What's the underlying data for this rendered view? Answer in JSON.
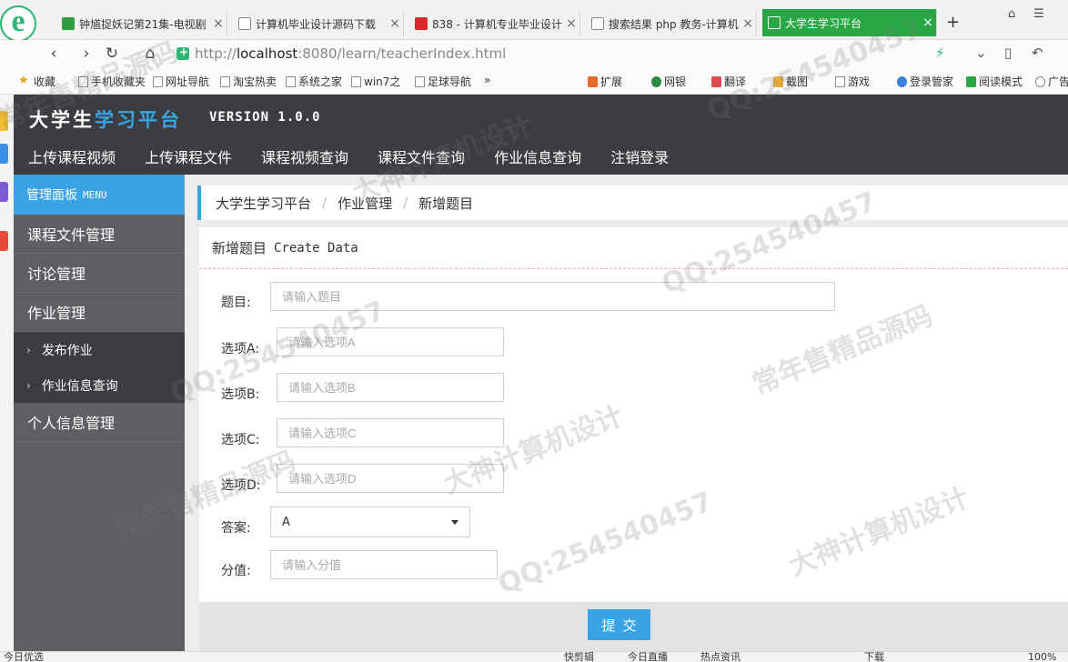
{
  "browser": {
    "logo_letter": "e",
    "tabs": [
      {
        "title": "钟馗捉妖记第21集-电视剧",
        "favicon_color": "#2e9e3e"
      },
      {
        "title": "计算机毕业设计源码下载",
        "favicon_color": "#ffffff"
      },
      {
        "title": "838 - 计算机专业毕业设计",
        "favicon_color": "#d62a2a"
      },
      {
        "title": "搜索结果 php 教务-计算机",
        "favicon_color": "#ffffff"
      },
      {
        "title": "大学生学习平台",
        "favicon_color": "#ffffff",
        "active": true
      }
    ],
    "new_tab": "+",
    "url": {
      "prefix": "http://",
      "host": "localhost",
      "rest": ":8080/learn/teacherIndex.html"
    },
    "bookmarks": [
      {
        "label": "收藏",
        "icon": "star-icon"
      },
      {
        "label": "手机收藏夹",
        "icon": "phone-icon"
      },
      {
        "label": "网址导航",
        "icon": "page-icon"
      },
      {
        "label": "淘宝热卖",
        "icon": "page-icon"
      },
      {
        "label": "系统之家",
        "icon": "page-icon"
      },
      {
        "label": "win7之",
        "icon": "page-icon"
      },
      {
        "label": "足球导航",
        "icon": "page-icon"
      }
    ],
    "bookmarks_more": "»",
    "right_tools": [
      {
        "label": "扩展",
        "icon": "grid-icon"
      },
      {
        "label": "网银",
        "icon": "bank-icon"
      },
      {
        "label": "翻译",
        "icon": "translate-icon"
      },
      {
        "label": "截图",
        "icon": "scissors-icon"
      },
      {
        "label": "游戏",
        "icon": "game-icon"
      },
      {
        "label": "登录管家",
        "icon": "key-icon"
      },
      {
        "label": "阅读模式",
        "icon": "book-icon"
      },
      {
        "label": "广告",
        "icon": "block-icon"
      }
    ]
  },
  "app": {
    "title_white": "大学生",
    "title_blue": "学习平台",
    "version": "VERSION 1.0.0",
    "topnav": [
      "上传课程视频",
      "上传课程文件",
      "课程视频查询",
      "课程文件查询",
      "作业信息查询",
      "注销登录"
    ],
    "sidebar": {
      "head": "管理面板",
      "head_mono": "MENU",
      "items": [
        "课程文件管理",
        "讨论管理",
        "作业管理"
      ],
      "subitems": [
        "发布作业",
        "作业信息查询"
      ],
      "after": [
        "个人信息管理"
      ]
    },
    "breadcrumb": [
      "大学生学习平台",
      "作业管理",
      "新增题目"
    ],
    "panel_title": "新增题目",
    "panel_title_mono": "Create Data",
    "form": {
      "title_label": "题目:",
      "title_placeholder": "请输入题目",
      "a_label": "选项A:",
      "a_placeholder": "请输入选项A",
      "b_label": "选项B:",
      "b_placeholder": "请输入选项B",
      "c_label": "选项C:",
      "c_placeholder": "请输入选项C",
      "d_label": "选项D:",
      "d_placeholder": "请输入选项D",
      "answer_label": "答案:",
      "answer_value": "A",
      "score_label": "分值:",
      "score_placeholder": "请输入分值"
    },
    "submit_label": "提交"
  },
  "statusbar": {
    "left": "今日优选",
    "items": [
      "快剪辑",
      "今日直播",
      "热点资讯",
      "下载",
      "100%"
    ]
  },
  "watermarks": [
    "常年售精品源码",
    "QQ:254540457",
    "大神计算机设计",
    "QQ:254540457",
    "常年售精品源码",
    "大神计算机设计",
    "QQ:254540457",
    "常年售精品源码",
    "QQ:254540457",
    "大神计算机设计"
  ],
  "colors": {
    "accent": "#3aa3e3",
    "header": "#3b3d41",
    "sidebar": "#5d5f63",
    "tab_active": "#2aa745"
  }
}
